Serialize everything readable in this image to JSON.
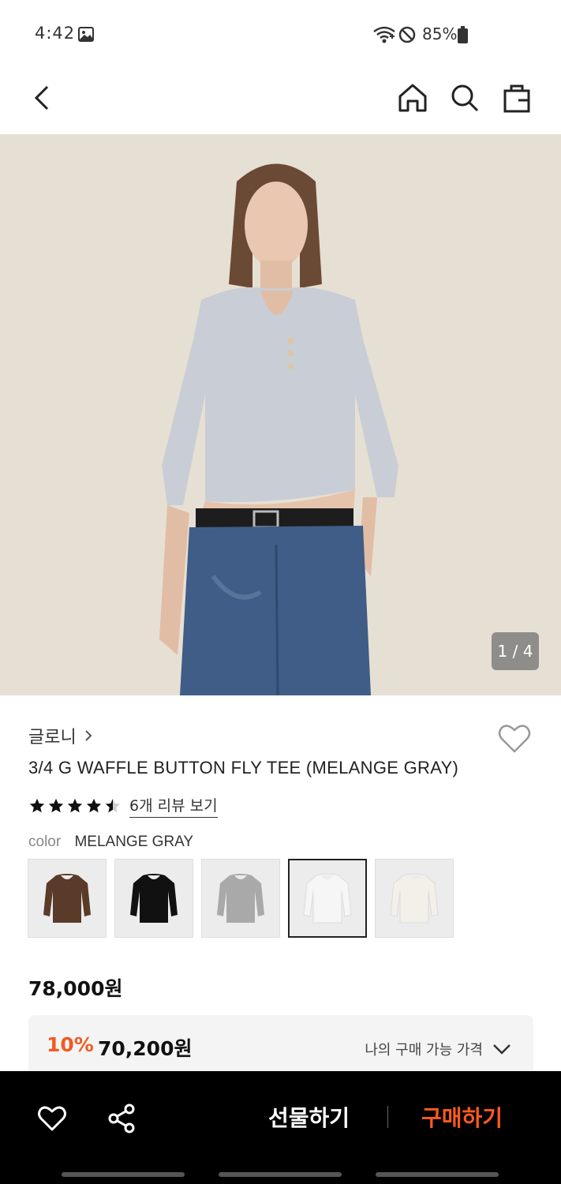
{
  "status_bar": {
    "time": "4:42",
    "battery_percent": "85%",
    "icons": [
      "gallery-icon",
      "wifi-icon",
      "do-not-disturb-icon",
      "battery-icon"
    ]
  },
  "nav": {
    "icons": [
      "back-icon",
      "home-icon",
      "search-icon",
      "shopping-bag-icon"
    ]
  },
  "gallery": {
    "counter": "1 / 4"
  },
  "product": {
    "brand": "글로니",
    "title": "3/4 G WAFFLE BUTTON FLY TEE (MELANGE GRAY)",
    "rating": 4.5,
    "review_link": "6개 리뷰 보기",
    "color_label": "color",
    "color_value": "MELANGE GRAY",
    "swatches": [
      {
        "color": "#5a3a28",
        "selected": false
      },
      {
        "color": "#111111",
        "selected": false
      },
      {
        "color": "#a9a9a9",
        "selected": false
      },
      {
        "color": "#f6f6f6",
        "selected": true
      },
      {
        "color": "#f3efe9",
        "selected": false
      }
    ],
    "price": "78,000원",
    "discount_percent": "10%",
    "discount_price": "70,200원",
    "my_price_label": "나의 구매 가능 가격"
  },
  "bottom_bar": {
    "gift_label": "선물하기",
    "buy_label": "구매하기"
  },
  "colors": {
    "accent": "#f05a22",
    "buy": "#ff5a1f",
    "bar": "#000000"
  }
}
